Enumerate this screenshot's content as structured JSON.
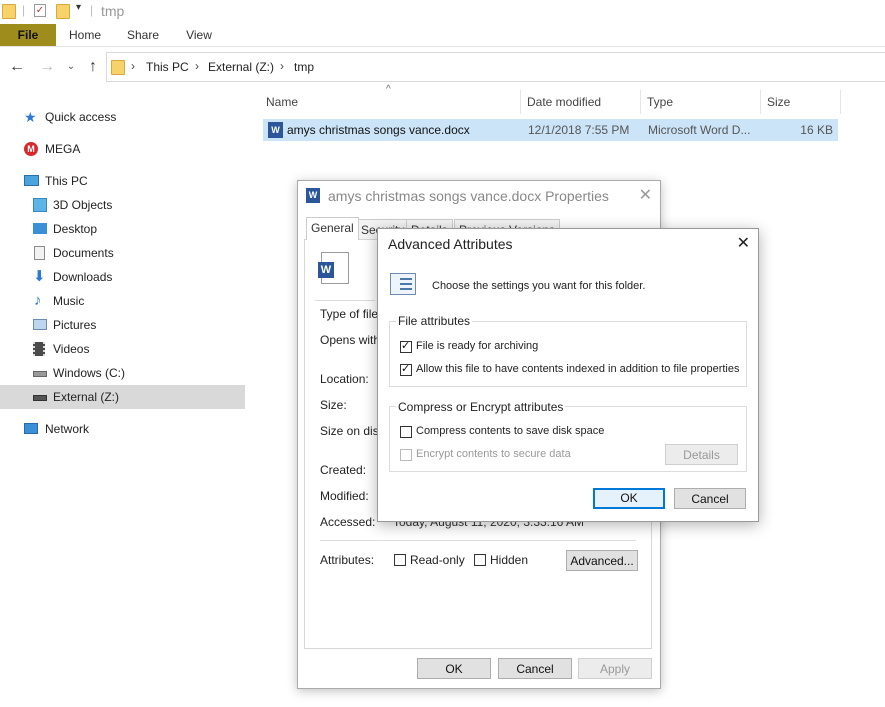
{
  "window": {
    "title": "tmp"
  },
  "ribbon": {
    "tabs": [
      "File",
      "Home",
      "Share",
      "View"
    ]
  },
  "address": {
    "crumbs": [
      "This PC",
      "External (Z:)",
      "tmp"
    ]
  },
  "sidebar": {
    "items": [
      {
        "label": "Quick access",
        "icon": "star-icon"
      },
      {
        "label": "MEGA",
        "icon": "mega-icon"
      },
      {
        "label": "This PC",
        "icon": "computer-icon"
      },
      {
        "label": "3D Objects",
        "icon": "cube-icon"
      },
      {
        "label": "Desktop",
        "icon": "desktop-icon"
      },
      {
        "label": "Documents",
        "icon": "documents-icon"
      },
      {
        "label": "Downloads",
        "icon": "download-arrow-icon"
      },
      {
        "label": "Music",
        "icon": "music-note-icon"
      },
      {
        "label": "Pictures",
        "icon": "pictures-icon"
      },
      {
        "label": "Videos",
        "icon": "film-icon"
      },
      {
        "label": "Windows (C:)",
        "icon": "drive-icon"
      },
      {
        "label": "External (Z:)",
        "icon": "drive-icon"
      },
      {
        "label": "Network",
        "icon": "network-icon"
      }
    ]
  },
  "filelist": {
    "columns": [
      "Name",
      "Date modified",
      "Type",
      "Size"
    ],
    "rows": [
      {
        "name": "amys christmas songs vance.docx",
        "date": "12/1/2018 7:55 PM",
        "type": "Microsoft Word D...",
        "size": "16 KB"
      }
    ]
  },
  "properties": {
    "title": "amys christmas songs vance.docx Properties",
    "tabs": [
      "General",
      "Security",
      "Details",
      "Previous Versions"
    ],
    "labels": [
      "Type of file:",
      "Opens with:",
      "Location:",
      "Size:",
      "Size on disk:",
      "Created:",
      "Modified:",
      "Accessed:",
      "Attributes:"
    ],
    "accessed_value": "Today, August 11, 2020, 3:33:16 AM",
    "readonly_label": "Read-only",
    "hidden_label": "Hidden",
    "advanced_label": "Advanced...",
    "ok_label": "OK",
    "cancel_label": "Cancel",
    "apply_label": "Apply"
  },
  "advanced": {
    "title": "Advanced Attributes",
    "intro": "Choose the settings you want for this folder.",
    "file_attr_group": "File attributes",
    "archive_label": "File is ready for archiving",
    "index_label": "Allow this file to have contents indexed in addition to file properties",
    "compress_group": "Compress or Encrypt attributes",
    "compress_label": "Compress contents to save disk space",
    "encrypt_label": "Encrypt contents to secure data",
    "details_label": "Details",
    "ok_label": "OK",
    "cancel_label": "Cancel",
    "archive_checked": true,
    "index_checked": true,
    "compress_checked": false,
    "encrypt_checked": false
  }
}
